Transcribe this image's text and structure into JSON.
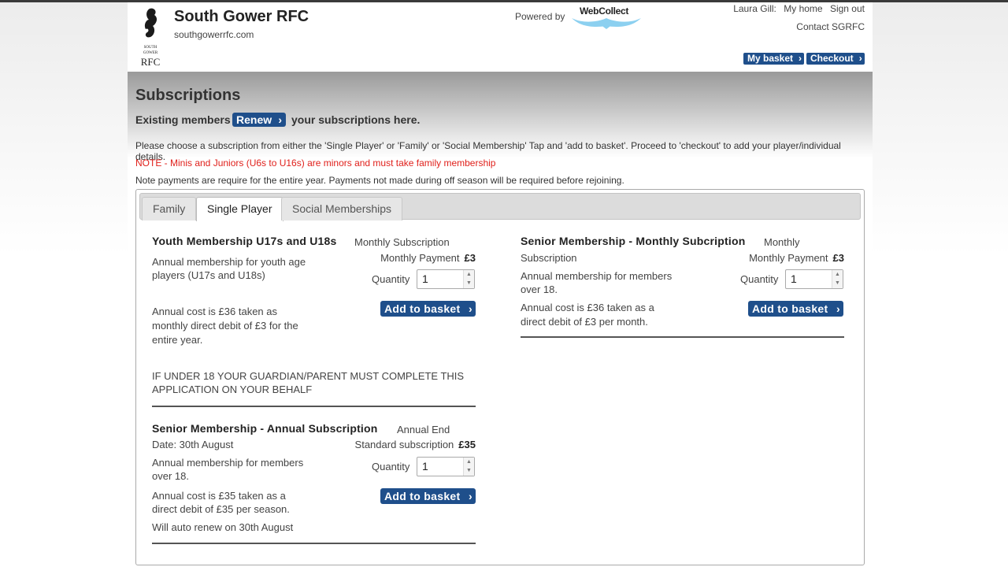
{
  "header": {
    "club_name": "South Gower RFC",
    "club_url": "southgowerrfc.com",
    "logo_text": [
      "SOUTH",
      "GOWER",
      "RFC"
    ],
    "powered_by": "Powered by",
    "webcollect": "WebCollect",
    "user_name": "Laura Gill:",
    "my_home": "My home",
    "sign_out": "Sign out",
    "contact": "Contact SGRFC",
    "my_basket": "My basket",
    "checkout": "Checkout"
  },
  "page": {
    "title": "Subscriptions",
    "existing_members": "Existing members",
    "renew": "Renew",
    "existing_tail": "your subscriptions here.",
    "instructions": "Please choose a subscription from either the 'Single Player' or 'Family' or 'Social Membership' Tap and 'add to basket'. Proceed to 'checkout' to add your player/individual details.",
    "note_red": "NOTE - Minis and Juniors (U6s to U16s) are minors and must take family membership",
    "note_payments": "Note payments are require for the entire year. Payments not made during off season will be required before rejoining."
  },
  "tabs": [
    {
      "label": "Family",
      "active": false
    },
    {
      "label": "Single Player",
      "active": true
    },
    {
      "label": "Social Memberships",
      "active": false
    }
  ],
  "items": {
    "youth": {
      "title": "Youth Membership U17s and U18s",
      "subtitle": "Monthly Subscription",
      "desc1": "Annual membership for youth age",
      "desc2": "players (U17s and U18s)",
      "price_label": "Monthly Payment",
      "price": "£3",
      "qty_label": "Quantity",
      "qty": "1",
      "cost1": "Annual cost is £36 taken as",
      "cost2": "monthly direct debit of £3 for the",
      "cost3": "entire year.",
      "warn1": "IF UNDER 18 YOUR GUARDIAN/PARENT MUST COMPLETE THIS",
      "warn2": "APPLICATION ON YOUR BEHALF",
      "add": "Add to basket"
    },
    "senior_annual": {
      "title": "Senior Membership - Annual Subscription",
      "subtitle1": "Annual End",
      "subtitle2": "Date: 30th August",
      "price_label": "Standard subscription",
      "price": "£35",
      "desc1": "Annual membership for members",
      "desc2": "over 18.",
      "qty_label": "Quantity",
      "qty": "1",
      "cost1": "Annual cost is £35 taken as a",
      "cost2": "direct debit of £35 per season.",
      "renew_note": "Will auto renew on 30th August",
      "add": "Add to basket"
    },
    "senior_monthly": {
      "title": "Senior Membership - Monthly Subcription",
      "subtitle1": "Monthly",
      "subtitle2": "Subscription",
      "price_label": "Monthly Payment",
      "price": "£3",
      "desc1": "Annual membership for members",
      "desc2": "over 18.",
      "qty_label": "Quantity",
      "qty": "1",
      "cost1": "Annual cost is £36 taken as a",
      "cost2": "direct debit of £3 per month.",
      "add": "Add to basket"
    }
  },
  "colors": {
    "accent": "#1f4f8b",
    "note": "#e0201b"
  },
  "icons": {
    "chevron": "chevron-right-icon",
    "spinner": "spinner-arrows-icon"
  }
}
